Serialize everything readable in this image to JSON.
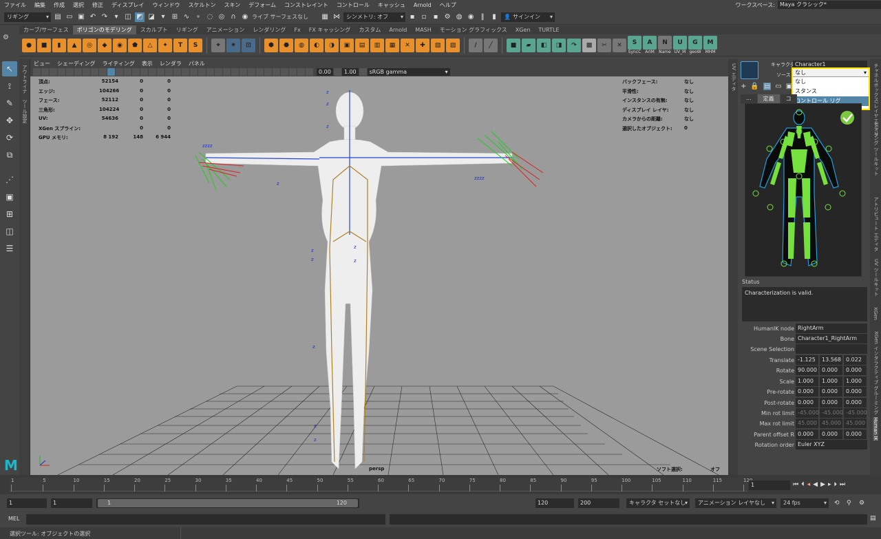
{
  "menu": [
    "ファイル",
    "編集",
    "作成",
    "選択",
    "修正",
    "ディスプレイ",
    "ウィンドウ",
    "スケルトン",
    "スキン",
    "デフォーム",
    "コンストレイント",
    "コントロール",
    "キャッシュ",
    "Arnold",
    "ヘルプ"
  ],
  "workspace": {
    "label": "ワークスペース:",
    "value": "Maya クラシック*"
  },
  "status": {
    "mode": "リギング",
    "live_surface": "ライブ サーフェスなし",
    "symmetry": "シンメトリ: オフ",
    "signin": "サインイン"
  },
  "shelf_tabs": [
    "カーブ/サーフェス",
    "ポリゴンのモデリング",
    "スカルプト",
    "リギング",
    "アニメーション",
    "レンダリング",
    "Fx",
    "FX キャッシング",
    "カスタム",
    "Arnold",
    "MASH",
    "モーション グラフィックス",
    "XGen",
    "TURTLE"
  ],
  "shelf_active": 1,
  "shelf_icons": [
    {
      "name": "sphere-icon",
      "c": "#e8902c",
      "g": "●"
    },
    {
      "name": "cube-icon",
      "c": "#e8902c",
      "g": "■"
    },
    {
      "name": "cylinder-icon",
      "c": "#e8902c",
      "g": "▮"
    },
    {
      "name": "cone-icon",
      "c": "#e8902c",
      "g": "▲"
    },
    {
      "name": "torus-icon",
      "c": "#e8902c",
      "g": "◎"
    },
    {
      "name": "plane-icon",
      "c": "#e8902c",
      "g": "◆"
    },
    {
      "name": "disc-icon",
      "c": "#e8902c",
      "g": "◉"
    },
    {
      "name": "platonic-icon",
      "c": "#e8902c",
      "g": "⬟"
    },
    {
      "name": "pyramid-icon",
      "c": "#e8902c",
      "g": "△"
    },
    {
      "name": "star-icon",
      "c": "#e8902c",
      "g": "✦"
    },
    {
      "name": "text-icon",
      "c": "#e8902c",
      "g": "T"
    },
    {
      "name": "svg-icon",
      "c": "#e8902c",
      "g": "S"
    },
    {
      "name": "sweep-icon",
      "c": "#777",
      "g": "⌖"
    },
    {
      "name": "poly-primitive-icon",
      "c": "#4a6a8a",
      "g": "✷"
    },
    {
      "name": "uv-icon",
      "c": "#4a6a8a",
      "g": "⊡"
    },
    {
      "name": "combine-icon",
      "c": "#e8902c",
      "g": "⬢"
    },
    {
      "name": "separate-icon",
      "c": "#e8902c",
      "g": "⬣"
    },
    {
      "name": "smooth-icon",
      "c": "#e8902c",
      "g": "◍"
    },
    {
      "name": "boolean-icon",
      "c": "#e8902c",
      "g": "◐"
    },
    {
      "name": "mirror-icon",
      "c": "#e8902c",
      "g": "◑"
    },
    {
      "name": "extrude-icon",
      "c": "#e8902c",
      "g": "▣"
    },
    {
      "name": "bridge-icon",
      "c": "#e8902c",
      "g": "▤"
    },
    {
      "name": "bevel-icon",
      "c": "#e8902c",
      "g": "▥"
    },
    {
      "name": "fill-icon",
      "c": "#e8902c",
      "g": "▦"
    },
    {
      "name": "multicut-icon",
      "c": "#e8902c",
      "g": "✕"
    },
    {
      "name": "target-weld-icon",
      "c": "#e8902c",
      "g": "✚"
    },
    {
      "name": "edge-loop-icon",
      "c": "#e8902c",
      "g": "▧"
    },
    {
      "name": "quad-draw-icon",
      "c": "#e8902c",
      "g": "▨"
    },
    {
      "name": "sculpt-icon",
      "c": "#777",
      "g": "/"
    },
    {
      "name": "soft-icon",
      "c": "#777",
      "g": "╱"
    },
    {
      "name": "cube-green-icon",
      "c": "#5aa590",
      "g": "■"
    },
    {
      "name": "cube-green2-icon",
      "c": "#5aa590",
      "g": "▰"
    },
    {
      "name": "cube-green3-icon",
      "c": "#5aa590",
      "g": "◧"
    },
    {
      "name": "cube-green4-icon",
      "c": "#5aa590",
      "g": "◨"
    },
    {
      "name": "arrow-green-icon",
      "c": "#5aa590",
      "g": "↷"
    },
    {
      "name": "checker-icon",
      "c": "#aaa",
      "g": "▩"
    },
    {
      "name": "tools-icon",
      "c": "#777",
      "g": "✂"
    },
    {
      "name": "cross-icon",
      "c": "#777",
      "g": "✕"
    },
    {
      "name": "sync-icon",
      "c": "#5aa590",
      "g": "S"
    },
    {
      "name": "arim-icon",
      "c": "#5aa590",
      "g": "A"
    },
    {
      "name": "name-icon",
      "c": "#777",
      "g": "N"
    },
    {
      "name": "uv-m-icon",
      "c": "#5aa590",
      "g": "U"
    },
    {
      "name": "geow-icon",
      "c": "#5aa590",
      "g": "G"
    },
    {
      "name": "mhm-icon",
      "c": "#5aa590",
      "g": "M"
    }
  ],
  "shelf_labels": [
    "SyncC",
    "ArIM",
    "Name",
    "UV_M",
    "geoW",
    "MHM"
  ],
  "panel_menu": [
    "ビュー",
    "シェーディング",
    "ライティング",
    "表示",
    "レンダラ",
    "パネル"
  ],
  "panel_values": {
    "exposure": "0.00",
    "gamma": "1.00",
    "colorspace": "sRGB gamma"
  },
  "hud_left": [
    {
      "label": "頂点:",
      "v1": "52154",
      "v2": "0",
      "v3": "0"
    },
    {
      "label": "エッジ:",
      "v1": "104266",
      "v2": "0",
      "v3": "0"
    },
    {
      "label": "フェース:",
      "v1": "52112",
      "v2": "0",
      "v3": "0"
    },
    {
      "label": "三角形:",
      "v1": "104224",
      "v2": "0",
      "v3": "0"
    },
    {
      "label": "UV:",
      "v1": "54636",
      "v2": "0",
      "v3": "0"
    },
    {
      "label": "XGen スプライン:",
      "v1": "",
      "v2": "0",
      "v3": "0"
    },
    {
      "label": "GPU メモリ:",
      "v1": "8 192",
      "v2": "148",
      "v3": "6 944"
    }
  ],
  "hud_right": [
    {
      "label": "バックフェース:",
      "v": "なし"
    },
    {
      "label": "平滑性:",
      "v": "なし"
    },
    {
      "label": "インスタンスの有無:",
      "v": "なし"
    },
    {
      "label": "ディスプレイ レイヤ:",
      "v": "なし"
    },
    {
      "label": "カメラからの距離:",
      "v": "なし"
    },
    {
      "label": "選択したオブジェクト:",
      "v": "0"
    }
  ],
  "hud_bottom": {
    "camera": "persp",
    "soft_select_label": "ソフト選択:",
    "soft_select_value": "オフ"
  },
  "hik": {
    "character_label": "キャラクタ:",
    "character_value": "Character1",
    "source_label": "ソース",
    "source_value": "なし",
    "source_options": [
      "なし",
      "スタンス",
      "コントロール リグ"
    ],
    "source_highlight": 2,
    "tabs": [
      "...",
      "定義",
      "コ"
    ],
    "status_label": "Status",
    "status_text": "Characterization is valid.",
    "node_label": "HumanIK node",
    "node_value": "RightArm",
    "bone_label": "Bone",
    "bone_value": "Character1_RightArm",
    "scene_sel_label": "Scene Selection",
    "rows": [
      {
        "label": "Translate",
        "v": [
          "-1.125",
          "13.568",
          "0.022"
        ]
      },
      {
        "label": "Rotate",
        "v": [
          "90.000",
          "0.000",
          "0.000"
        ]
      },
      {
        "label": "Scale",
        "v": [
          "1.000",
          "1.000",
          "1.000"
        ]
      },
      {
        "label": "Pre-rotate",
        "v": [
          "0.000",
          "0.000",
          "0.000"
        ]
      },
      {
        "label": "Post-rotate",
        "v": [
          "0.000",
          "0.000",
          "0.000"
        ]
      },
      {
        "label": "Min rot limit",
        "v": [
          "-45.000",
          "-45.000",
          "-45.000"
        ]
      },
      {
        "label": "Max rot limit",
        "v": [
          "45.000",
          "45.000",
          "45.000"
        ]
      },
      {
        "label": "Parent offset R",
        "v": [
          "0.000",
          "0.000",
          "0.000"
        ]
      }
    ],
    "rotation_order_label": "Rotation order",
    "rotation_order_value": "Euler XYZ"
  },
  "right_strip": [
    "チャネルボックス/レイヤエディタ",
    "モデリング ツールキット",
    "アトリビュート エディタ",
    "UV ツールキット",
    "XGen",
    "XGen インタラクティブ グルーミング エディタ",
    "Human IK"
  ],
  "left_strip": [
    "アウトライナ",
    "ツール設定"
  ],
  "uv_strip": "UV エディタ",
  "timeline": {
    "ticks": [
      "1",
      "5",
      "10",
      "15",
      "20",
      "25",
      "30",
      "35",
      "40",
      "45",
      "50",
      "55",
      "60",
      "65",
      "70",
      "75",
      "80",
      "85",
      "90",
      "95",
      "100",
      "105",
      "110",
      "115",
      "120"
    ],
    "current": "1"
  },
  "range": {
    "start": "1",
    "start2": "1",
    "slider_start": "1",
    "slider_end": "120",
    "end": "120",
    "end2": "200",
    "char_set": "キャラクタ セットなし",
    "anim_layer": "アニメーション レイヤなし",
    "fps": "24 fps"
  },
  "mel_label": "MEL",
  "help_text": "選択ツール: オブジェクトの選択",
  "colors": {
    "highlight": "#ffe400",
    "accent": "#5285a6",
    "bg": "#444444",
    "viewport": "#9b9b9b"
  }
}
